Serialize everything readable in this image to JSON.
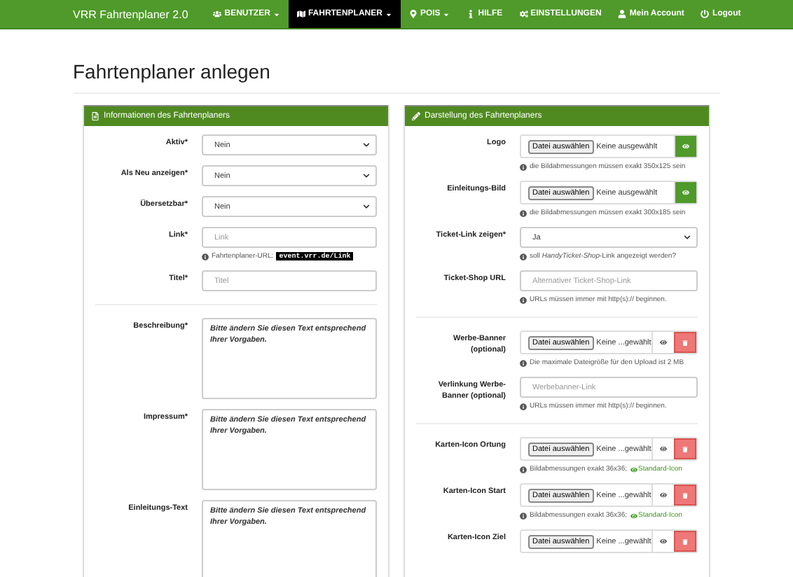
{
  "navbar": {
    "brand": "VRR Fahrtenplaner 2.0",
    "items": [
      {
        "kind": "users",
        "label": "BENUTZER",
        "dropdown": true,
        "selected": false
      },
      {
        "kind": "map",
        "label": "FAHRTENPLANER",
        "dropdown": true,
        "selected": true
      },
      {
        "kind": "marker",
        "label": "POIS",
        "dropdown": true,
        "selected": false
      },
      {
        "kind": "info",
        "label": "HILFE",
        "dropdown": false,
        "selected": false
      },
      {
        "kind": "cogs",
        "label": "EINSTELLUNGEN",
        "dropdown": false,
        "selected": false
      }
    ],
    "right_items": [
      {
        "kind": "user",
        "label": "Mein Account"
      },
      {
        "kind": "power",
        "label": "Logout"
      }
    ]
  },
  "page_title": "Fahrtenplaner anlegen",
  "panels": [
    {
      "kind": "document",
      "title": "Informationen des Fahrtenplaners",
      "groups": [
        [
          {
            "kind": "select",
            "label": "Aktiv*",
            "value": "Nein"
          },
          {
            "kind": "select",
            "label": "Als Neu anzeigen*",
            "value": "Nein"
          },
          {
            "kind": "select",
            "label": "Übersetzbar*",
            "value": "Nein"
          },
          {
            "kind": "text",
            "label": "Link*",
            "placeholder": "Link",
            "help": {
              "text": "Fahrtenplaner-URL:",
              "code": "event.vrr.de/Link"
            }
          },
          {
            "kind": "text",
            "label": "Titel*",
            "placeholder": "Titel"
          }
        ],
        [
          {
            "kind": "textarea",
            "label": "Beschreibung*",
            "value": "Bitte ändern Sie diesen Text entsprechend Ihrer Vorgaben."
          },
          {
            "kind": "textarea",
            "label": "Impressum*",
            "value": "Bitte ändern Sie diesen Text entsprechend Ihrer Vorgaben."
          },
          {
            "kind": "textarea",
            "label": "Einleitungs-Text",
            "value": "Bitte ändern Sie diesen Text entsprechend Ihrer Vorgaben."
          }
        ]
      ]
    },
    {
      "kind": "pencil",
      "title": "Darstellung des Fahrtenplaners",
      "groups": [
        [
          {
            "kind": "file",
            "label": "Logo",
            "button": "Datei auswählen",
            "value": "Keine ausgewählt",
            "preview_highlighted": true,
            "deletable": false,
            "help": {
              "text": "die Bildabmessungen müssen exakt 350x125 sein"
            }
          },
          {
            "kind": "file",
            "label": "Einleitungs-Bild",
            "button": "Datei auswählen",
            "value": "Keine ausgewählt",
            "preview_highlighted": true,
            "deletable": false,
            "help": {
              "text": "die Bildabmessungen müssen exakt 300x185 sein"
            }
          },
          {
            "kind": "select",
            "label": "Ticket-Link zeigen*",
            "value": "Ja",
            "help": {
              "text": "soll *HandyTicket-Shop*-Link angezeigt werden?"
            }
          },
          {
            "kind": "text",
            "label": "Ticket-Shop URL",
            "placeholder": "Alternativer Ticket-Shop-Link",
            "help": {
              "text": "URLs müssen immer mit http(s):// beginnen."
            }
          }
        ],
        [
          {
            "kind": "file",
            "label": "Werbe-Banner (optional)",
            "button": "Datei auswählen",
            "value": "Keine ...gewählt",
            "preview_highlighted": false,
            "deletable": true,
            "help": {
              "text": "Die maximale Dateigröße für den Upload ist 2 MB"
            }
          },
          {
            "kind": "text",
            "label": "Verlinkung Werbe-Banner (optional)",
            "placeholder": "Werbebanner-Link",
            "help": {
              "text": "URLs müssen immer mit http(s):// beginnen."
            }
          }
        ],
        [
          {
            "kind": "file",
            "label": "Karten-Icon Ortung",
            "button": "Datei auswählen",
            "value": "Keine ...gewählt",
            "preview_highlighted": false,
            "deletable": true,
            "help": {
              "text": "Bildabmessungen exakt 36x36;",
              "link": "Standard-Icon"
            }
          },
          {
            "kind": "file",
            "label": "Karten-Icon Start",
            "button": "Datei auswählen",
            "value": "Keine ...gewählt",
            "preview_highlighted": false,
            "deletable": true,
            "help": {
              "text": "Bildabmessungen exakt 36x36;",
              "link": "Standard-Icon"
            }
          },
          {
            "kind": "file",
            "label": "Karten-Icon Ziel",
            "button": "Datei auswählen",
            "value": "Keine ...gewählt",
            "preview_highlighted": false,
            "deletable": true
          }
        ]
      ]
    }
  ]
}
